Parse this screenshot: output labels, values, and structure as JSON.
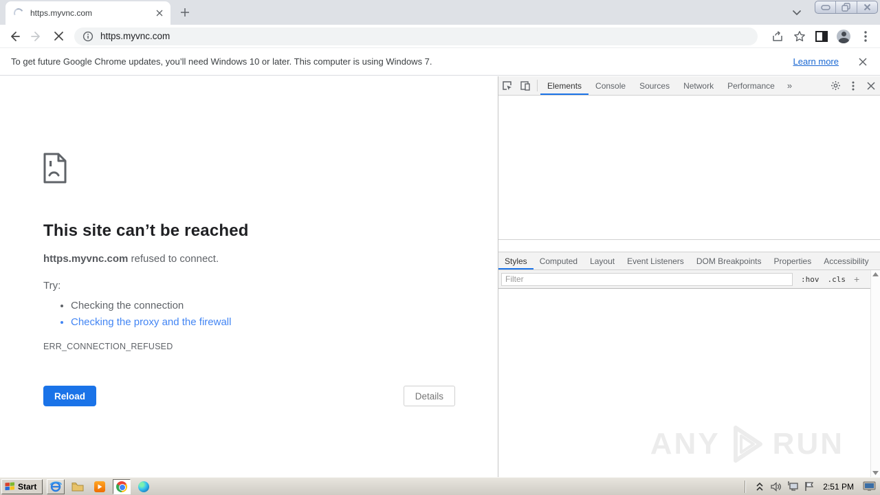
{
  "browser": {
    "tab_title": "https.myvnc.com",
    "url": "https.myvnc.com",
    "infobar": {
      "message": "To get future Google Chrome updates, you’ll need Windows 10 or later. This computer is using Windows 7.",
      "learn_more": "Learn more"
    }
  },
  "error_page": {
    "title": "This site can’t be reached",
    "domain": "https.myvnc.com",
    "reason": " refused to connect.",
    "try_label": "Try:",
    "suggestions": [
      "Checking the connection",
      "Checking the proxy and the firewall"
    ],
    "error_code": "ERR_CONNECTION_REFUSED",
    "reload_label": "Reload",
    "details_label": "Details"
  },
  "devtools": {
    "tabs": [
      "Elements",
      "Console",
      "Sources",
      "Network",
      "Performance"
    ],
    "active_tab": "Elements",
    "more_tabs_glyph": "»",
    "sidebar_tabs": [
      "Styles",
      "Computed",
      "Layout",
      "Event Listeners",
      "DOM Breakpoints",
      "Properties",
      "Accessibility"
    ],
    "active_sidebar_tab": "Styles",
    "filter_placeholder": "Filter",
    "pseudo_toggle": ":hov",
    "class_toggle": ".cls",
    "new_rule_glyph": "+"
  },
  "watermark": {
    "left": "ANY",
    "right": "RUN"
  },
  "taskbar": {
    "start_label": "Start",
    "time": "2:51 PM"
  },
  "colors": {
    "accent_blue": "#1a73e8",
    "link_blue": "#4285f4",
    "reload_button": "#1a73e8"
  }
}
